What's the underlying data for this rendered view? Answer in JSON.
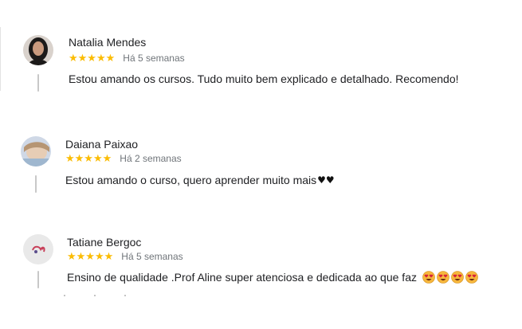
{
  "reviews": [
    {
      "name": "Natalia Mendes",
      "stars": "★★★★★",
      "rating": 5,
      "date": "Há 5 semanas",
      "text": "Estou amando os cursos. Tudo muito bem explicado e detalhado. Recomendo!"
    },
    {
      "name": "Daiana Paixao",
      "stars": "★★★★★",
      "rating": 5,
      "date": "Há 2 semanas",
      "text": "Estou amando o curso, quero aprender muito mais",
      "trailing_emoji": "♥♥"
    },
    {
      "name": "Tatiane Bergoc",
      "stars": "★★★★★",
      "rating": 5,
      "date": "Há 5 semanas",
      "text": "Ensino de qualidade .Prof Aline super atenciosa e dedicada ao que faz",
      "trailing_emoji_count": 4
    }
  ],
  "colors": {
    "star": "#fbbc04",
    "date": "#70757a",
    "text": "#202124",
    "thread_line": "#c8c8c8"
  },
  "icons": {
    "avatar_1": "woman-dark-hair-avatar-icon",
    "avatar_2": "woman-light-photo-avatar-icon",
    "avatar_3": "logo-avatar-icon",
    "emoji": "heart-eyes-emoji-icon"
  }
}
